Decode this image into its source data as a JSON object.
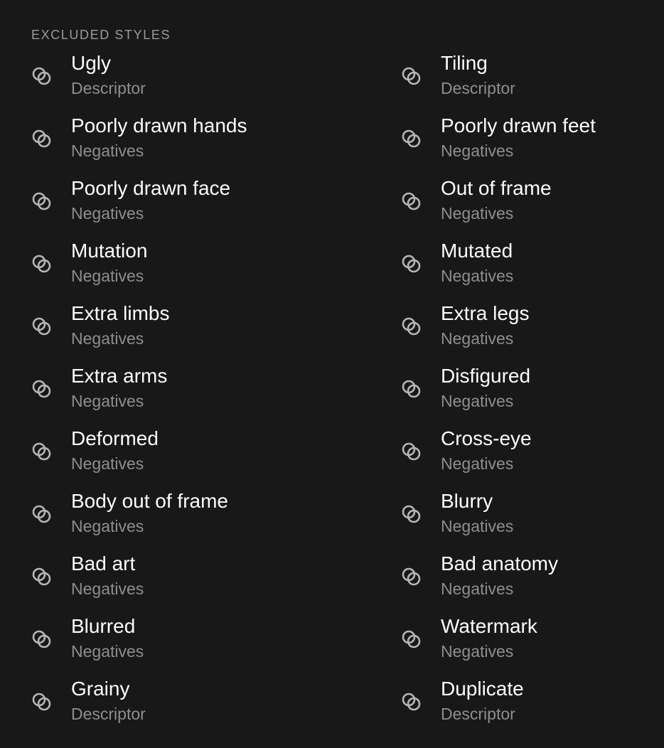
{
  "section": {
    "title": "EXCLUDED STYLES"
  },
  "icon_name": "linked-circles-icon",
  "colors": {
    "background": "#181818",
    "title": "#9a9a9a",
    "name": "#ffffff",
    "category": "#8e8e8e",
    "icon": "#b5b5b5"
  },
  "items": [
    {
      "name": "Ugly",
      "category": "Descriptor"
    },
    {
      "name": "Tiling",
      "category": "Descriptor"
    },
    {
      "name": "Poorly drawn hands",
      "category": "Negatives"
    },
    {
      "name": "Poorly drawn feet",
      "category": "Negatives"
    },
    {
      "name": "Poorly drawn face",
      "category": "Negatives"
    },
    {
      "name": "Out of frame",
      "category": "Negatives"
    },
    {
      "name": "Mutation",
      "category": "Negatives"
    },
    {
      "name": "Mutated",
      "category": "Negatives"
    },
    {
      "name": "Extra limbs",
      "category": "Negatives"
    },
    {
      "name": "Extra legs",
      "category": "Negatives"
    },
    {
      "name": "Extra arms",
      "category": "Negatives"
    },
    {
      "name": "Disfigured",
      "category": "Negatives"
    },
    {
      "name": "Deformed",
      "category": "Negatives"
    },
    {
      "name": "Cross-eye",
      "category": "Negatives"
    },
    {
      "name": "Body out of frame",
      "category": "Negatives"
    },
    {
      "name": "Blurry",
      "category": "Negatives"
    },
    {
      "name": "Bad art",
      "category": "Negatives"
    },
    {
      "name": "Bad anatomy",
      "category": "Negatives"
    },
    {
      "name": "Blurred",
      "category": "Negatives"
    },
    {
      "name": "Watermark",
      "category": "Negatives"
    },
    {
      "name": "Grainy",
      "category": "Descriptor"
    },
    {
      "name": "Duplicate",
      "category": "Descriptor"
    }
  ]
}
